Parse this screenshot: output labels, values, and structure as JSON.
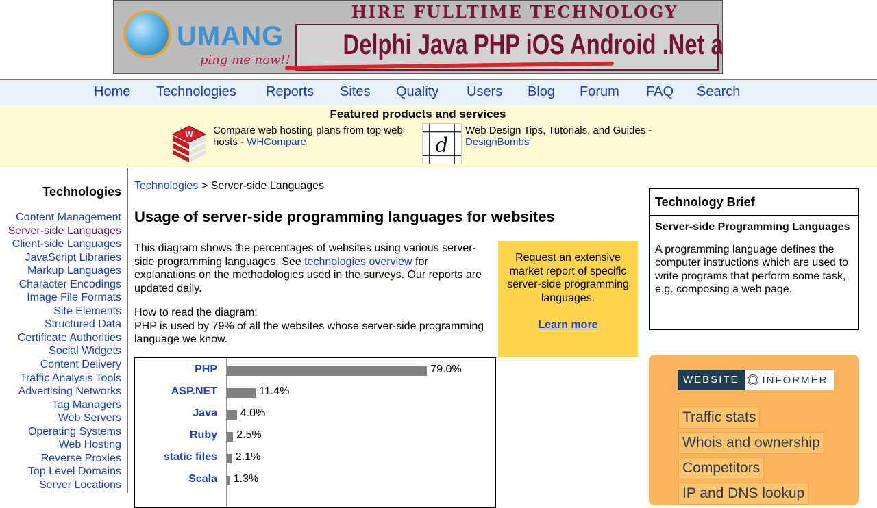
{
  "banner": {
    "logo_text": "UMANG",
    "logo_tagline": "ping me now!!",
    "headline": "HIRE FULLTIME TECHNOLOGY EXPERTS",
    "technologies": "Delphi Java PHP iOS Android .Net and more..."
  },
  "nav": {
    "items": [
      "Home",
      "Technologies",
      "Reports",
      "Sites",
      "Quality",
      "Users",
      "Blog",
      "Forum",
      "FAQ",
      "Search"
    ]
  },
  "featured": {
    "title": "Featured products and services",
    "item1": {
      "text": "Compare web hosting plans from top web hosts - ",
      "link": "WHCompare"
    },
    "item2": {
      "text": "Web Design Tips, Tutorials, and Guides - ",
      "link": "DesignBombs"
    }
  },
  "sidebar": {
    "title": "Technologies",
    "items": [
      "Content Management",
      "Server-side Languages",
      "Client-side Languages",
      "JavaScript Libraries",
      "Markup Languages",
      "Character Encodings",
      "Image File Formats",
      "Site Elements",
      "Structured Data",
      "Certificate Authorities",
      "Social Widgets",
      "Content Delivery",
      "Traffic Analysis Tools",
      "Advertising Networks",
      "Tag Managers",
      "Web Servers",
      "Operating Systems",
      "Web Hosting",
      "Reverse Proxies",
      "Top Level Domains",
      "Server Locations"
    ],
    "active": "Server-side Languages"
  },
  "main": {
    "breadcrumb_link": "Technologies",
    "breadcrumb_sep": " > ",
    "breadcrumb_current": "Server-side Languages",
    "title": "Usage of server-side programming languages for websites",
    "intro_1": "This diagram shows the percentages of websites using various server-side programming languages. See ",
    "intro_link": "technologies overview",
    "intro_2": " for explanations on the methodologies used in the surveys. Our reports are updated daily.",
    "howto_1": "How to read the diagram:",
    "howto_2": "PHP is used by 79% of all the websites whose server-side programming language we know."
  },
  "cta": {
    "text": "Request an extensive market report of specific server-side programming languages.",
    "link": "Learn more"
  },
  "chart_data": {
    "type": "bar",
    "orientation": "horizontal",
    "categories": [
      "PHP",
      "ASP.NET",
      "Java",
      "Ruby",
      "static files",
      "Scala"
    ],
    "values": [
      79.0,
      11.4,
      4.0,
      2.5,
      2.1,
      1.3
    ],
    "value_labels": [
      "79.0%",
      "11.4%",
      "4.0%",
      "2.5%",
      "2.1%",
      "1.3%"
    ],
    "xlim": [
      0,
      100
    ],
    "bar_color": "#808080"
  },
  "brief": {
    "title": "Technology Brief",
    "subtitle": "Server-side Programming Languages",
    "text": "A programming language defines the computer instructions which are used to write programs that perform some task, e.g. composing a web page."
  },
  "informer": {
    "logo_left": "WEBSITE",
    "logo_right": "INFORMER",
    "items": [
      "Traffic stats",
      "Whois and ownership",
      "Competitors",
      "IP and DNS lookup"
    ]
  },
  "colors": {
    "link": "#1a3fc2",
    "nav_bg": "#e7f2fb",
    "featured_bg": "#fdfbd5",
    "cta_bg": "#fdd44a",
    "informer_bg": "#fbb45c"
  }
}
